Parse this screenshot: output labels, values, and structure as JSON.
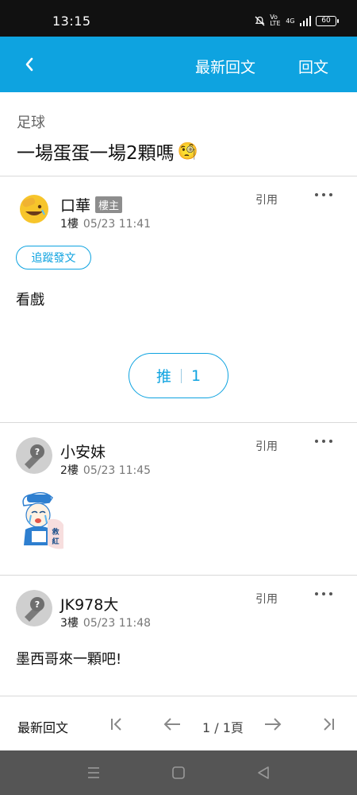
{
  "status_bar": {
    "time": "13:15",
    "network_label": "4G",
    "volte_label": "Vo LTE",
    "battery": "60"
  },
  "app_bar": {
    "back_icon": "chevron-left-icon",
    "latest_label": "最新回文",
    "reply_label": "回文"
  },
  "thread": {
    "board": "足球",
    "title": "一場蛋蛋一場2顆嗎",
    "title_emoji": "🧐"
  },
  "posts": [
    {
      "author": "口華",
      "badge": "樓主",
      "floor": "1樓",
      "time": "05/23 11:41",
      "quote_label": "引用",
      "follow_label": "追蹤發文",
      "body": "看戲",
      "push_label": "推",
      "push_count": "1",
      "avatar_icon": "face-palm-emoji-avatar"
    },
    {
      "author": "小安妹",
      "floor": "2樓",
      "time": "05/23 11:45",
      "quote_label": "引用",
      "sticker_text": "救紅",
      "avatar_icon": "default-avatar-icon"
    },
    {
      "author": "JK978大",
      "floor": "3樓",
      "time": "05/23 11:48",
      "quote_label": "引用",
      "body": "墨西哥來一顆吧!",
      "avatar_icon": "default-avatar-icon"
    }
  ],
  "pager": {
    "latest_label": "最新回文",
    "page_info": "1 / 1頁"
  },
  "colors": {
    "accent": "#0ea3e0",
    "status_bar": "#111111",
    "system_nav": "#555555"
  }
}
